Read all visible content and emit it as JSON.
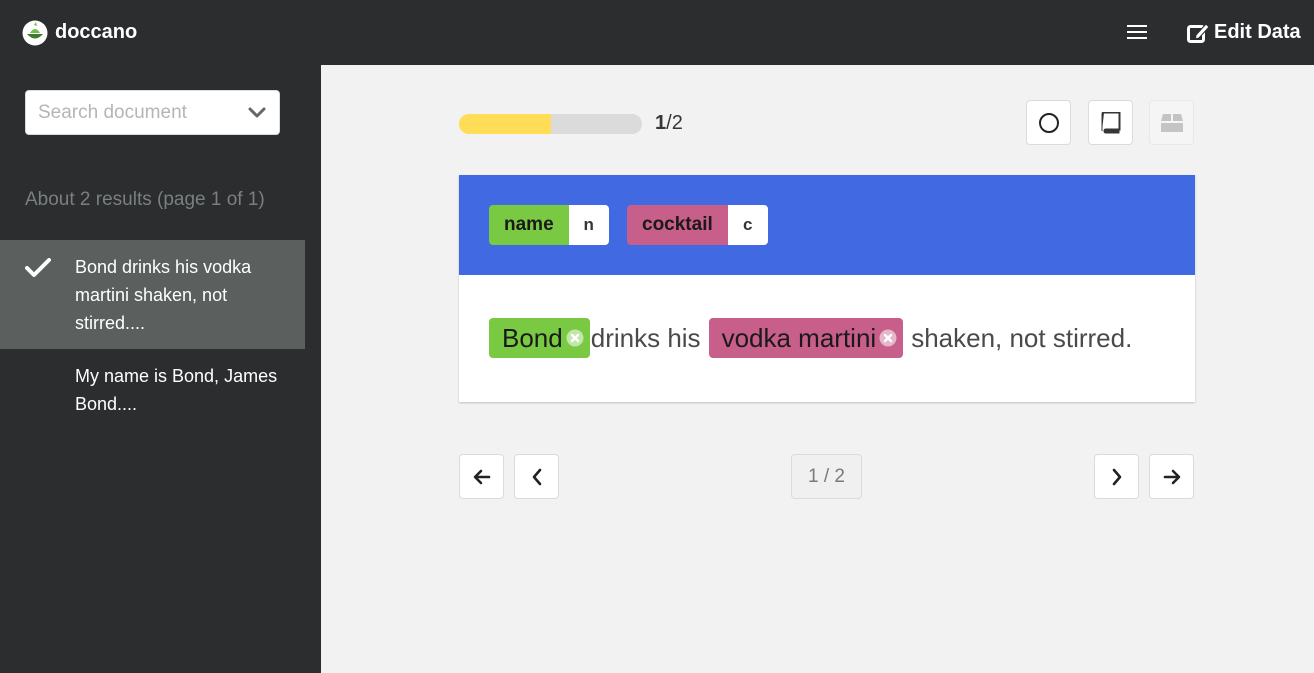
{
  "app": {
    "brand": "doccano",
    "edit_label": "Edit Data"
  },
  "sidebar": {
    "search_placeholder": "Search document",
    "results_text": "About 2 results (page 1 of 1)",
    "documents": [
      {
        "text": "Bond drinks his vodka martini shaken, not stirred....",
        "selected": true,
        "checked": true
      },
      {
        "text": "My name is Bond, James Bond....",
        "selected": false,
        "checked": false
      }
    ]
  },
  "progress": {
    "current": "1",
    "separator": "/",
    "total": "2",
    "fraction": 0.5
  },
  "labels": [
    {
      "name": "name",
      "key": "n",
      "color": "#7ac943"
    },
    {
      "name": "cocktail",
      "key": "c",
      "color": "#c85e8a"
    }
  ],
  "document": {
    "entity1": "Bond",
    "text1": "drinks his",
    "entity2": "vodka martini",
    "text2": "shaken, not stirred."
  },
  "pagination": {
    "indicator": "1 / 2"
  },
  "colors": {
    "topbar": "#2b2d2e",
    "label_bar": "#4169e1",
    "progress_fill": "#ffdd57",
    "name_label": "#7ac943",
    "cocktail_label": "#c85e8a"
  }
}
